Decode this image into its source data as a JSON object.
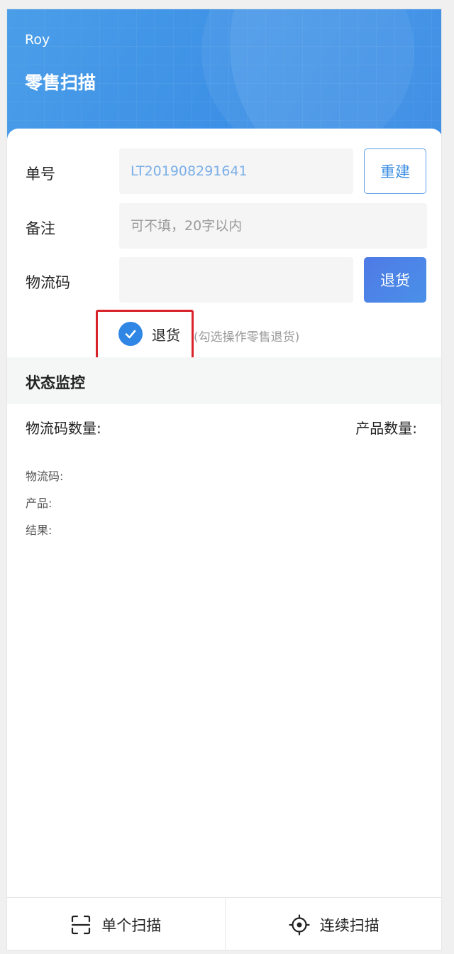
{
  "header": {
    "user_name": "Roy",
    "title": "零售扫描"
  },
  "form": {
    "order_label": "单号",
    "order_value": "LT201908291641",
    "rebuild_button": "重建",
    "remark_label": "备注",
    "remark_placeholder": "可不填，20字以内",
    "logistics_label": "物流码",
    "logistics_value": "",
    "return_button": "退货",
    "return_checkbox_label": "退货",
    "return_checkbox_hint": "(勾选操作零售退货)",
    "return_checked": true
  },
  "monitor": {
    "section_title": "状态监控",
    "logistics_count_label": "物流码数量:",
    "product_count_label": "产品数量:",
    "lines": [
      "物流码:",
      "产品:",
      "结果:"
    ]
  },
  "tabbar": {
    "single_scan": "单个扫描",
    "continuous_scan": "连续扫描"
  },
  "colors": {
    "primary": "#2f86e4",
    "highlight": "#d8232a"
  }
}
